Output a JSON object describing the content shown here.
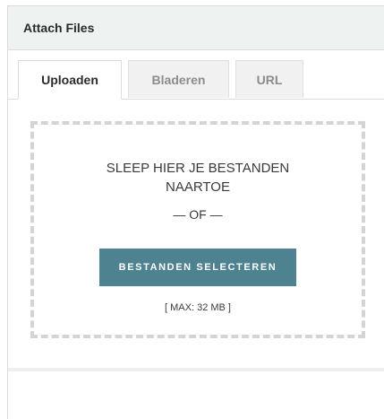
{
  "panel": {
    "title": "Attach Files"
  },
  "tabs": [
    {
      "label": "Uploaden",
      "active": true
    },
    {
      "label": "Bladeren",
      "active": false
    },
    {
      "label": "URL",
      "active": false
    }
  ],
  "dropzone": {
    "instruction": "SLEEP HIER JE BESTANDEN NAARTOE",
    "or": "— OF —",
    "button_label": "BESTANDEN SELECTEREN",
    "max_size": "[ MAX: 32 MB ]"
  },
  "colors": {
    "header_bg": "#eef2f1",
    "button_bg": "#4e8290",
    "dashed_border": "#d4d4d4",
    "inactive_tab_bg": "#f1f1f1"
  }
}
